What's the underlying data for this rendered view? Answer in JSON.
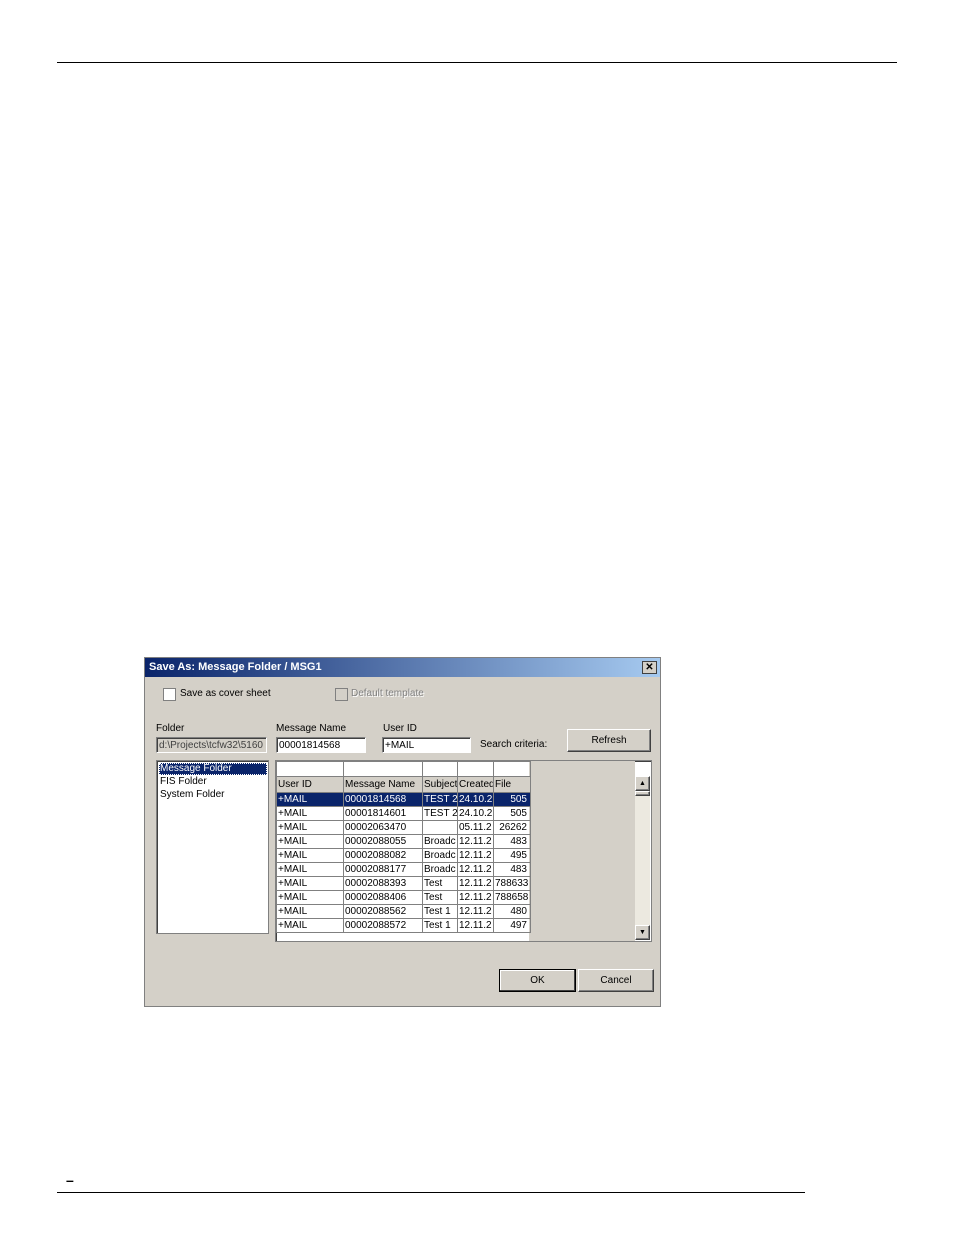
{
  "page": {
    "footer_mark": "–"
  },
  "dialog": {
    "title": "Save As: Message Folder / MSG1",
    "close_icon": "close-icon",
    "save_as_cover_sheet": {
      "label": "Save as cover sheet",
      "checked": false
    },
    "default_template": {
      "label": "Default template",
      "checked": false,
      "enabled": false
    },
    "folder": {
      "label": "Folder",
      "value": "d:\\Projects\\tcfw32\\5160"
    },
    "message_name": {
      "label": "Message Name",
      "value": "00001814568"
    },
    "user_id": {
      "label": "User ID",
      "value": "+MAIL"
    },
    "search_criteria_label": "Search criteria:",
    "refresh_label": "Refresh",
    "folders": [
      "Message Folder",
      "FIS Folder",
      "System Folder"
    ],
    "selected_folder": "Message Folder",
    "columns": [
      "User ID",
      "Message Name",
      "Subject",
      "Created",
      "File"
    ],
    "rows": [
      [
        "+MAIL",
        "00001814568",
        "TEST 2",
        "24.10.2",
        "505"
      ],
      [
        "+MAIL",
        "00001814601",
        "TEST 2",
        "24.10.2",
        "505"
      ],
      [
        "+MAIL",
        "00002063470",
        "",
        "05.11.2",
        "26262"
      ],
      [
        "+MAIL",
        "00002088055",
        "Broadc",
        "12.11.2",
        "483"
      ],
      [
        "+MAIL",
        "00002088082",
        "Broadc",
        "12.11.2",
        "495"
      ],
      [
        "+MAIL",
        "00002088177",
        "Broadc",
        "12.11.2",
        "483"
      ],
      [
        "+MAIL",
        "00002088393",
        "Test",
        "12.11.2",
        "788633"
      ],
      [
        "+MAIL",
        "00002088406",
        "Test",
        "12.11.2",
        "788658"
      ],
      [
        "+MAIL",
        "00002088562",
        "Test 1",
        "12.11.2",
        "480"
      ],
      [
        "+MAIL",
        "00002088572",
        "Test 1",
        "12.11.2",
        "497"
      ]
    ],
    "selected_row": 0,
    "ok_label": "OK",
    "cancel_label": "Cancel"
  }
}
